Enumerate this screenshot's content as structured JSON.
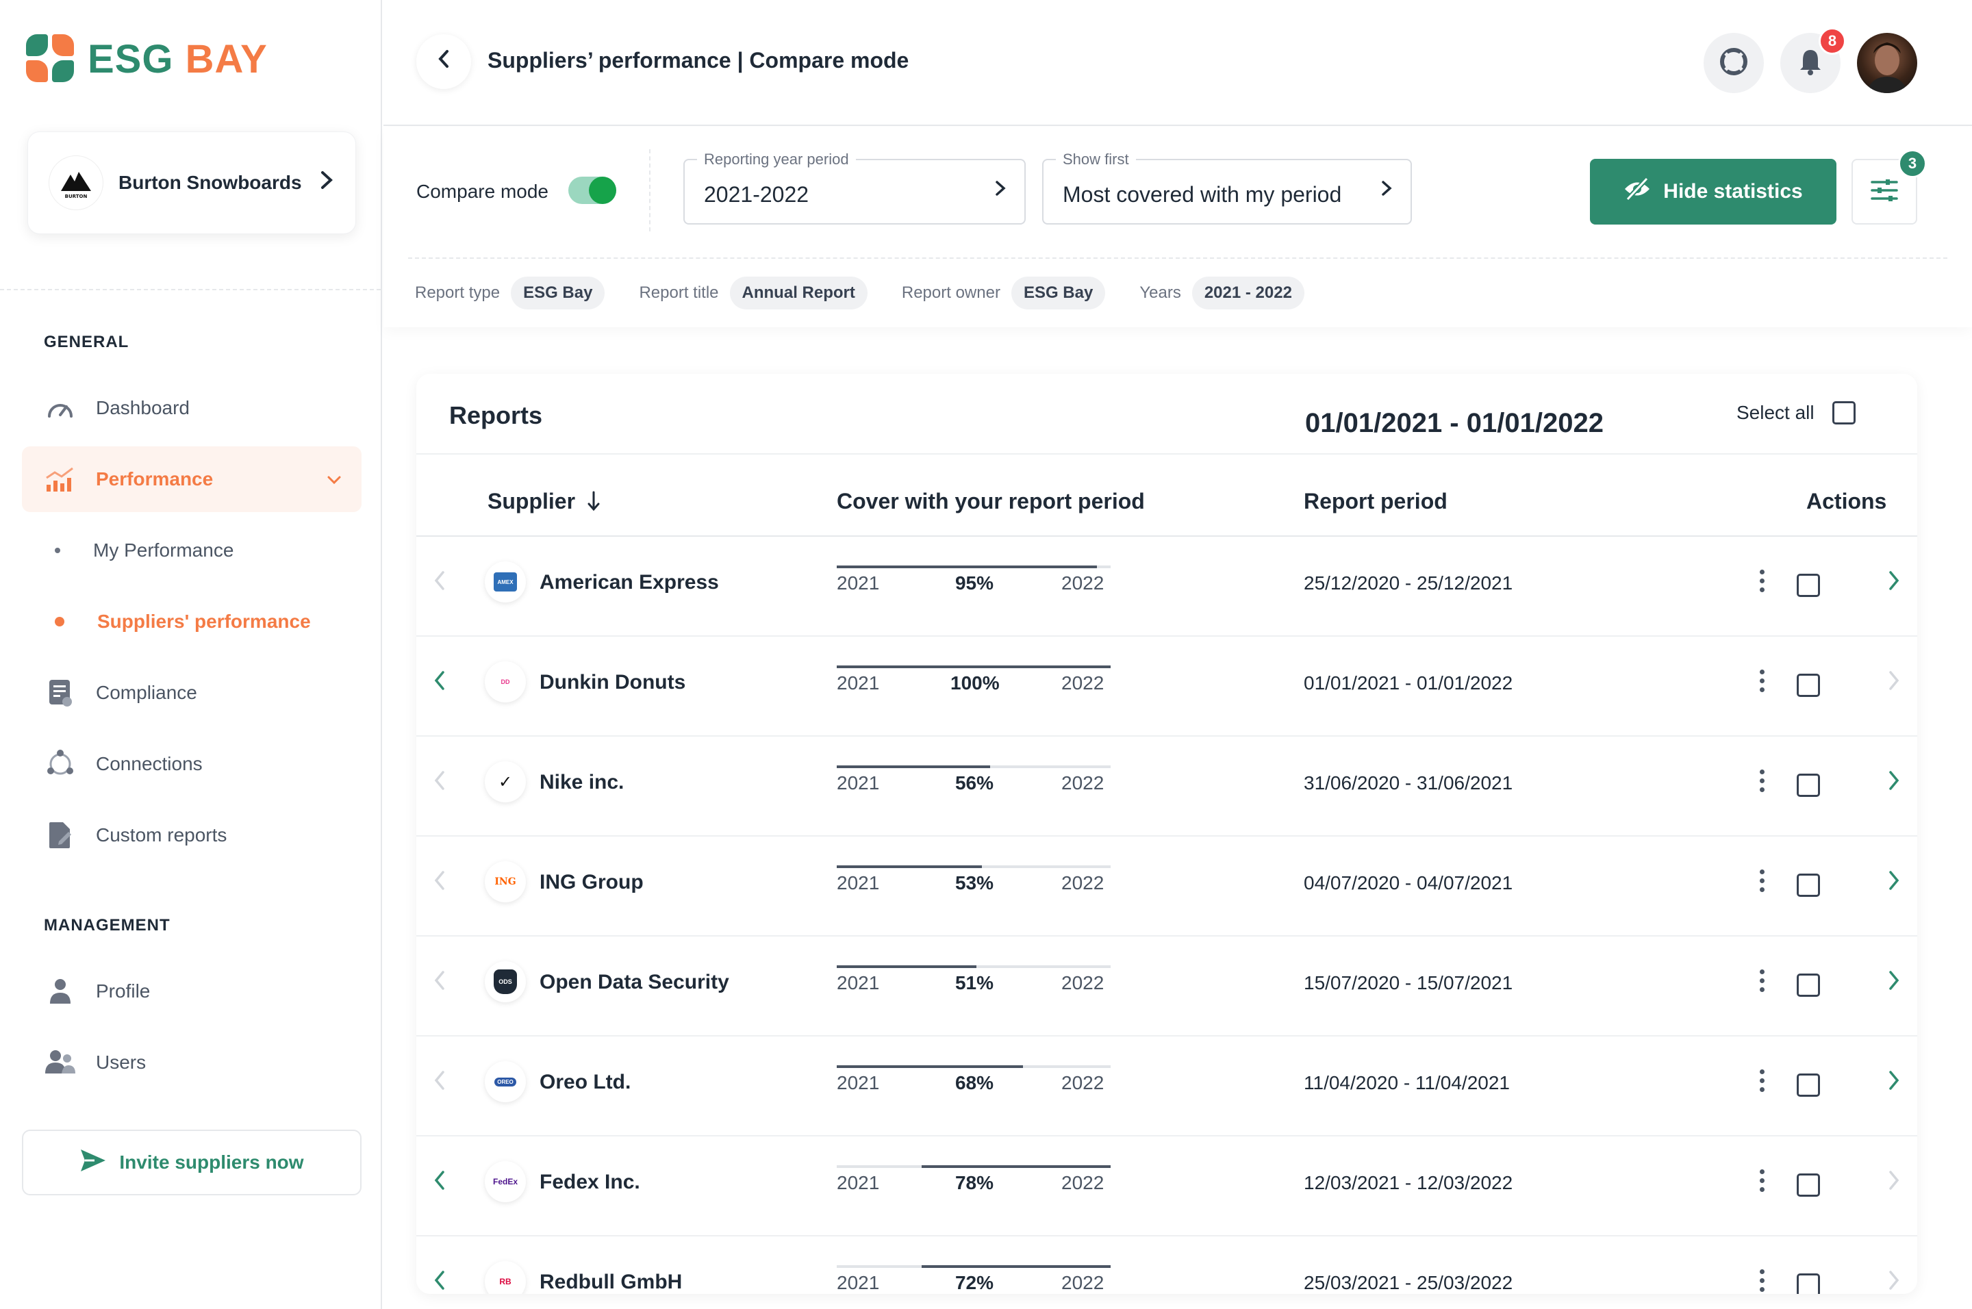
{
  "brand": {
    "name_part1": "ESG",
    "name_part2": "BAY",
    "color_green": "#2e8b6e",
    "color_orange": "#f47b45"
  },
  "sidebar": {
    "company": {
      "name": "Burton Snowboards",
      "logo_text": "BURTON"
    },
    "sections": {
      "general": "GENERAL",
      "management": "MANAGEMENT"
    },
    "items": {
      "dashboard": "Dashboard",
      "performance": "Performance",
      "my_performance": "My Performance",
      "suppliers_performance": "Suppliers' performance",
      "compliance": "Compliance",
      "connections": "Connections",
      "custom_reports": "Custom reports",
      "profile": "Profile",
      "users": "Users"
    },
    "invite_label": "Invite suppliers now"
  },
  "header": {
    "title": "Suppliers’ performance | Compare mode",
    "notifications_count": "8"
  },
  "filters": {
    "compare_mode_label": "Compare mode",
    "compare_mode_on": true,
    "reporting_year": {
      "label": "Reporting year period",
      "value": "2021-2022"
    },
    "show_first": {
      "label": "Show first",
      "value": "Most covered with my period"
    },
    "hide_stats_label": "Hide statistics",
    "filter_count": "3",
    "chips": [
      {
        "label": "Report type",
        "value": "ESG Bay"
      },
      {
        "label": "Report title",
        "value": "Annual Report"
      },
      {
        "label": "Report owner",
        "value": "ESG Bay"
      },
      {
        "label": "Years",
        "value": "2021 - 2022"
      }
    ]
  },
  "reports": {
    "title": "Reports",
    "range": "01/01/2021 - 01/01/2022",
    "select_all_label": "Select all",
    "columns": {
      "supplier": "Supplier",
      "cover": "Cover with your report period",
      "period": "Report period",
      "actions": "Actions"
    },
    "rows": [
      {
        "name": "American Express",
        "start_year": "2021",
        "end_year": "2022",
        "cover": "95%",
        "bar_start": 0.0,
        "bar_end": 0.95,
        "period": "25/12/2020 - 25/12/2021",
        "prev_enabled": false,
        "next_enabled": true,
        "logo": "AMEX"
      },
      {
        "name": "Dunkin Donuts",
        "start_year": "2021",
        "end_year": "2022",
        "cover": "100%",
        "bar_start": 0.0,
        "bar_end": 1.0,
        "period": "01/01/2021 - 01/01/2022",
        "prev_enabled": true,
        "next_enabled": false,
        "logo": "DD"
      },
      {
        "name": "Nike inc.",
        "start_year": "2021",
        "end_year": "2022",
        "cover": "56%",
        "bar_start": 0.0,
        "bar_end": 0.56,
        "period": "31/06/2020 - 31/06/2021",
        "prev_enabled": false,
        "next_enabled": true,
        "logo": "✓"
      },
      {
        "name": "ING Group",
        "start_year": "2021",
        "end_year": "2022",
        "cover": "53%",
        "bar_start": 0.0,
        "bar_end": 0.53,
        "period": "04/07/2020 - 04/07/2021",
        "prev_enabled": false,
        "next_enabled": true,
        "logo": "ING"
      },
      {
        "name": "Open Data Security",
        "start_year": "2021",
        "end_year": "2022",
        "cover": "51%",
        "bar_start": 0.0,
        "bar_end": 0.51,
        "period": "15/07/2020 - 15/07/2021",
        "prev_enabled": false,
        "next_enabled": true,
        "logo": "ODS"
      },
      {
        "name": "Oreo Ltd.",
        "start_year": "2021",
        "end_year": "2022",
        "cover": "68%",
        "bar_start": 0.0,
        "bar_end": 0.68,
        "period": "11/04/2020 - 11/04/2021",
        "prev_enabled": false,
        "next_enabled": true,
        "logo": "OREO"
      },
      {
        "name": "Fedex Inc.",
        "start_year": "2021",
        "end_year": "2022",
        "cover": "78%",
        "bar_start": 0.31,
        "bar_end": 1.0,
        "period": "12/03/2021 - 12/03/2022",
        "prev_enabled": true,
        "next_enabled": false,
        "logo": "FedEx"
      },
      {
        "name": "Redbull GmbH",
        "start_year": "2021",
        "end_year": "2022",
        "cover": "72%",
        "bar_start": 0.31,
        "bar_end": 1.0,
        "period": "25/03/2021 - 25/03/2022",
        "prev_enabled": true,
        "next_enabled": false,
        "logo": "RB"
      }
    ]
  }
}
